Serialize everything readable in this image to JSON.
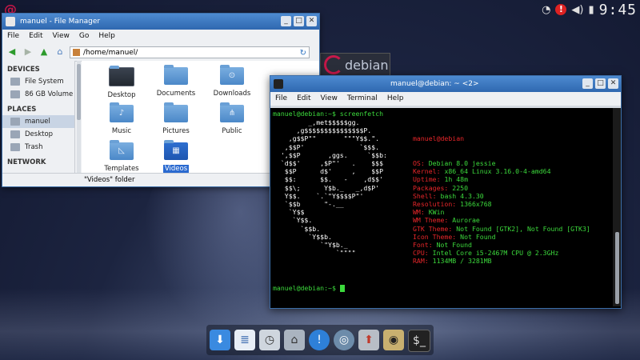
{
  "top_panel": {
    "clock": "9:45",
    "tray_icons": [
      "wifi-icon",
      "update-icon",
      "volume-icon",
      "battery-icon"
    ]
  },
  "badge": {
    "text": "debian"
  },
  "file_manager": {
    "title": "manuel - File Manager",
    "menu": [
      "File",
      "Edit",
      "View",
      "Go",
      "Help"
    ],
    "address": "/home/manuel/",
    "sidebar": {
      "devices_header": "DEVICES",
      "devices": [
        "File System",
        "86 GB Volume"
      ],
      "places_header": "PLACES",
      "places": [
        "manuel",
        "Desktop",
        "Trash"
      ],
      "network_header": "NETWORK"
    },
    "items": [
      "Desktop",
      "Documents",
      "Downloads",
      "Music",
      "Pictures",
      "Public",
      "Templates",
      "Videos"
    ],
    "selected_item": "Videos",
    "status": "\"Videos\" folder"
  },
  "terminal": {
    "title": "manuel@debian: ~ <2>",
    "menu": [
      "File",
      "Edit",
      "View",
      "Terminal",
      "Help"
    ],
    "command_prompt": "manuel@debian:~$ screenfetch",
    "final_prompt": "manuel@debian:~$ ",
    "art_lines": [
      "         _,met$$$$$gg.",
      "      ,g$$$$$$$$$$$$$$$P.",
      "    ,g$$P\"\"       \"\"\"Y$$.\".",
      "   ,$$P'              `$$$.",
      "  ',$$P       ,ggs.     `$$b:",
      "  `d$$'     ,$P\"'   .    $$$",
      "   $$P      d$'     ,    $$P",
      "   $$:      $$.   -    ,d$$'",
      "   $$\\;      Y$b._   _,d$P'",
      "   Y$$.    `.`\"Y$$$$P\"'",
      "   `$$b      \"-.__",
      "    `Y$$",
      "     `Y$$.",
      "       `$$b.",
      "         `Y$$b.",
      "            `\"Y$b._",
      "                `\"\"\"\""
    ],
    "info_header": "manuel@debian",
    "info": [
      {
        "k": "OS:",
        "v": "Debian 8.0 jessie"
      },
      {
        "k": "Kernel:",
        "v": "x86_64 Linux 3.16.0-4-amd64"
      },
      {
        "k": "Uptime:",
        "v": "1h 48m"
      },
      {
        "k": "Packages:",
        "v": "2250"
      },
      {
        "k": "Shell:",
        "v": "bash 4.3.30"
      },
      {
        "k": "Resolution:",
        "v": "1366x768"
      },
      {
        "k": "WM:",
        "v": "KWin"
      },
      {
        "k": "WM Theme:",
        "v": "Aurorae"
      },
      {
        "k": "GTK Theme:",
        "v": "Not Found [GTK2], Not Found [GTK3]"
      },
      {
        "k": "Icon Theme:",
        "v": "Not Found"
      },
      {
        "k": "Font:",
        "v": "Not Found"
      },
      {
        "k": "CPU:",
        "v": "Intel Core i5-2467M CPU @ 2.3GHz"
      },
      {
        "k": "RAM:",
        "v": "1134MB / 3281MB"
      }
    ]
  },
  "dock": {
    "items": [
      "download-icon",
      "text-editor-icon",
      "clock-icon",
      "file-manager-icon",
      "notification-icon",
      "browser-icon",
      "installer-icon",
      "speaker-icon",
      "terminal-icon"
    ]
  }
}
